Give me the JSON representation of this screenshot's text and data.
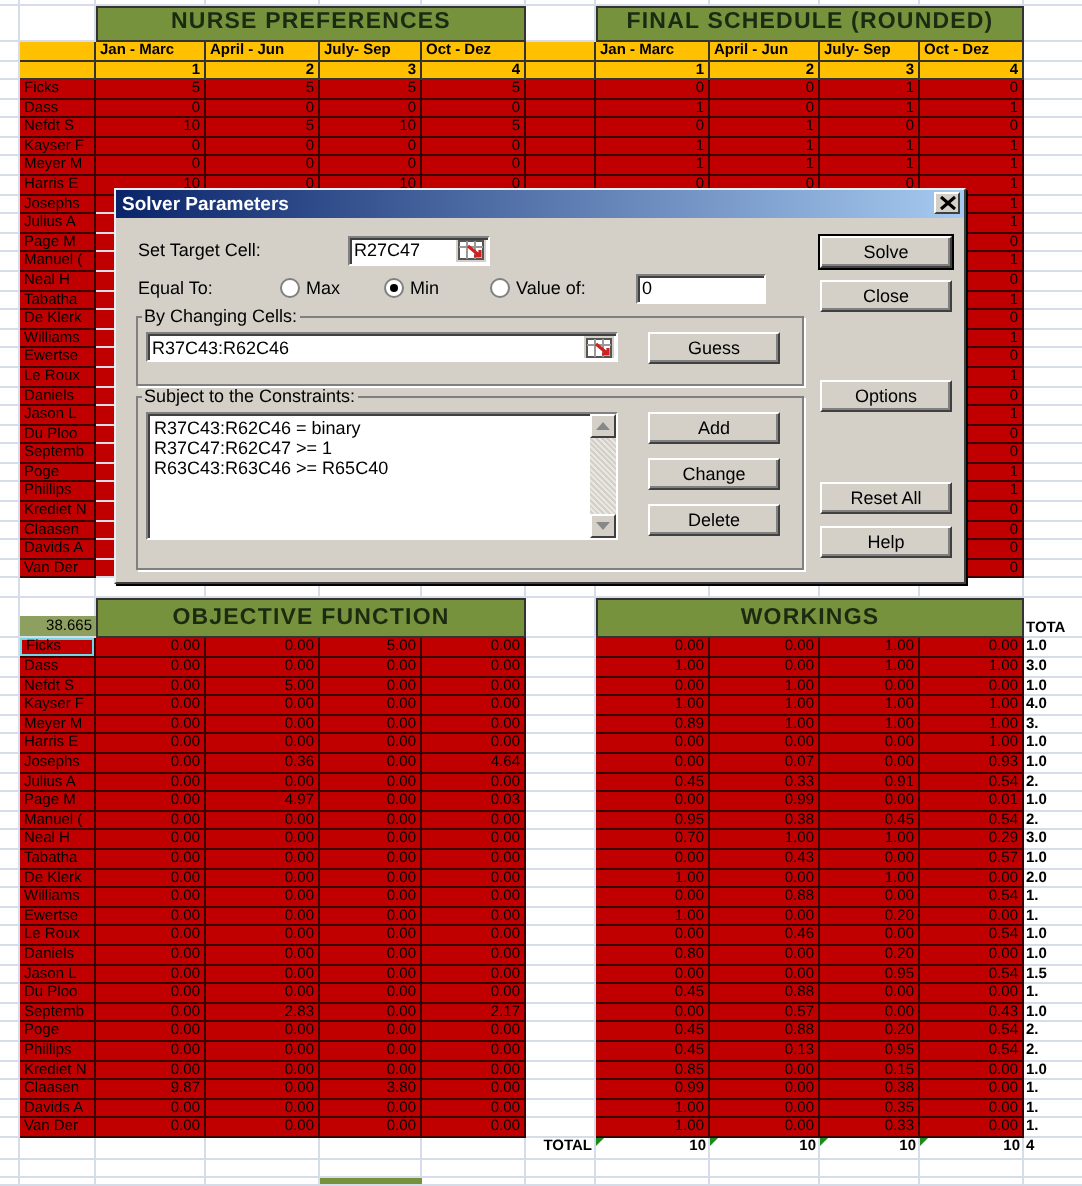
{
  "nurse_preferences": {
    "title": "NURSE PREFERENCES",
    "columns": [
      "Jan - Marc",
      "April - Jun",
      "July- Sep",
      "Oct - Dez"
    ],
    "numbers": [
      "1",
      "2",
      "3",
      "4"
    ]
  },
  "final_schedule": {
    "title": "FINAL SCHEDULE (ROUNDED)",
    "columns": [
      "Jan - Marc",
      "April - Jun",
      "July- Sep",
      "Oct - Dez"
    ],
    "numbers": [
      "1",
      "2",
      "3",
      "4"
    ]
  },
  "top_rows": [
    {
      "name": "Ficks",
      "prefs": [
        "5",
        "5",
        "5",
        "5"
      ],
      "schedule": [
        "0",
        "0",
        "1",
        "0"
      ]
    },
    {
      "name": "Dass",
      "prefs": [
        "0",
        "0",
        "0",
        "0"
      ],
      "schedule": [
        "1",
        "0",
        "1",
        "1"
      ]
    },
    {
      "name": "Nefdt S",
      "prefs": [
        "10",
        "5",
        "10",
        "5"
      ],
      "schedule": [
        "0",
        "1",
        "0",
        "0"
      ]
    },
    {
      "name": "Kayser F",
      "prefs": [
        "0",
        "0",
        "0",
        "0"
      ],
      "schedule": [
        "1",
        "1",
        "1",
        "1"
      ]
    },
    {
      "name": "Meyer M",
      "prefs": [
        "0",
        "0",
        "0",
        "0"
      ],
      "schedule": [
        "1",
        "1",
        "1",
        "1"
      ]
    },
    {
      "name": "Harris E",
      "prefs": [
        "10",
        "0",
        "10",
        "0"
      ],
      "schedule": [
        "0",
        "0",
        "0",
        "1"
      ]
    },
    {
      "name": "Josephs",
      "schedule": [
        "1"
      ]
    },
    {
      "name": "Julius A",
      "schedule": [
        "1"
      ]
    },
    {
      "name": "Page M",
      "schedule": [
        "0"
      ]
    },
    {
      "name": "Manuel (",
      "schedule": [
        "1"
      ]
    },
    {
      "name": "Neal H",
      "schedule": [
        "0"
      ]
    },
    {
      "name": "Tabatha",
      "schedule": [
        "1"
      ]
    },
    {
      "name": "De Klerk",
      "schedule": [
        "0"
      ]
    },
    {
      "name": "Williams",
      "schedule": [
        "1"
      ]
    },
    {
      "name": "Ewertse",
      "schedule": [
        "0"
      ]
    },
    {
      "name": "Le Roux",
      "schedule": [
        "1"
      ]
    },
    {
      "name": "Daniels",
      "schedule": [
        "0"
      ]
    },
    {
      "name": "Jason L",
      "schedule": [
        "1"
      ]
    },
    {
      "name": "Du Ploo",
      "schedule": [
        "0"
      ]
    },
    {
      "name": "Septemb",
      "schedule": [
        "0"
      ]
    },
    {
      "name": "Poge",
      "schedule": [
        "1"
      ]
    },
    {
      "name": "Phillips",
      "schedule": [
        "1"
      ]
    },
    {
      "name": "Krediet N",
      "schedule": [
        "0"
      ]
    },
    {
      "name": "Claasen",
      "schedule": [
        "0"
      ]
    },
    {
      "name": "Davids A",
      "schedule": [
        "0"
      ]
    },
    {
      "name": "Van Der",
      "schedule": [
        "0"
      ]
    }
  ],
  "objective_score": "38.665",
  "objective_function": {
    "title": "OBJECTIVE FUNCTION"
  },
  "workings": {
    "title": "WORKINGS",
    "total_heading": "TOTA"
  },
  "bottom_rows": [
    {
      "name": "Ficks",
      "selected": true,
      "objective": [
        "0.00",
        "0.00",
        "5.00",
        "0.00"
      ],
      "workings": [
        "0.00",
        "0.00",
        "1.00",
        "0.00"
      ],
      "total": "1.0"
    },
    {
      "name": "Dass",
      "selected": false,
      "objective": [
        "0.00",
        "0.00",
        "0.00",
        "0.00"
      ],
      "workings": [
        "1.00",
        "0.00",
        "1.00",
        "1.00"
      ],
      "total": "3.0"
    },
    {
      "name": "Nefdt S",
      "selected": false,
      "objective": [
        "0.00",
        "5.00",
        "0.00",
        "0.00"
      ],
      "workings": [
        "0.00",
        "1.00",
        "0.00",
        "0.00"
      ],
      "total": "1.0"
    },
    {
      "name": "Kayser F",
      "selected": false,
      "objective": [
        "0.00",
        "0.00",
        "0.00",
        "0.00"
      ],
      "workings": [
        "1.00",
        "1.00",
        "1.00",
        "1.00"
      ],
      "total": "4.0"
    },
    {
      "name": "Meyer M",
      "selected": false,
      "objective": [
        "0.00",
        "0.00",
        "0.00",
        "0.00"
      ],
      "workings": [
        "0.89",
        "1.00",
        "1.00",
        "1.00"
      ],
      "total": "3."
    },
    {
      "name": "Harris E",
      "selected": false,
      "objective": [
        "0.00",
        "0.00",
        "0.00",
        "0.00"
      ],
      "workings": [
        "0.00",
        "0.00",
        "0.00",
        "1.00"
      ],
      "total": "1.0"
    },
    {
      "name": "Josephs",
      "selected": false,
      "objective": [
        "0.00",
        "0.36",
        "0.00",
        "4.64"
      ],
      "workings": [
        "0.00",
        "0.07",
        "0.00",
        "0.93"
      ],
      "total": "1.0"
    },
    {
      "name": "Julius A",
      "selected": false,
      "objective": [
        "0.00",
        "0.00",
        "0.00",
        "0.00"
      ],
      "workings": [
        "0.45",
        "0.33",
        "0.91",
        "0.54"
      ],
      "total": "2."
    },
    {
      "name": "Page M",
      "selected": false,
      "objective": [
        "0.00",
        "4.97",
        "0.00",
        "0.03"
      ],
      "workings": [
        "0.00",
        "0.99",
        "0.00",
        "0.01"
      ],
      "total": "1.0"
    },
    {
      "name": "Manuel (",
      "selected": false,
      "objective": [
        "0.00",
        "0.00",
        "0.00",
        "0.00"
      ],
      "workings": [
        "0.95",
        "0.38",
        "0.45",
        "0.54"
      ],
      "total": "2."
    },
    {
      "name": "Neal H",
      "selected": false,
      "objective": [
        "0.00",
        "0.00",
        "0.00",
        "0.00"
      ],
      "workings": [
        "0.70",
        "1.00",
        "1.00",
        "0.29"
      ],
      "total": "3.0"
    },
    {
      "name": "Tabatha",
      "selected": false,
      "objective": [
        "0.00",
        "0.00",
        "0.00",
        "0.00"
      ],
      "workings": [
        "0.00",
        "0.43",
        "0.00",
        "0.57"
      ],
      "total": "1.0"
    },
    {
      "name": "De Klerk",
      "selected": false,
      "objective": [
        "0.00",
        "0.00",
        "0.00",
        "0.00"
      ],
      "workings": [
        "1.00",
        "0.00",
        "1.00",
        "0.00"
      ],
      "total": "2.0"
    },
    {
      "name": "Williams",
      "selected": false,
      "objective": [
        "0.00",
        "0.00",
        "0.00",
        "0.00"
      ],
      "workings": [
        "0.00",
        "0.88",
        "0.00",
        "0.54"
      ],
      "total": "1."
    },
    {
      "name": "Ewertse",
      "selected": false,
      "objective": [
        "0.00",
        "0.00",
        "0.00",
        "0.00"
      ],
      "workings": [
        "1.00",
        "0.00",
        "0.20",
        "0.00"
      ],
      "total": "1."
    },
    {
      "name": "Le Roux",
      "selected": false,
      "objective": [
        "0.00",
        "0.00",
        "0.00",
        "0.00"
      ],
      "workings": [
        "0.00",
        "0.46",
        "0.00",
        "0.54"
      ],
      "total": "1.0"
    },
    {
      "name": "Daniels",
      "selected": false,
      "objective": [
        "0.00",
        "0.00",
        "0.00",
        "0.00"
      ],
      "workings": [
        "0.80",
        "0.00",
        "0.20",
        "0.00"
      ],
      "total": "1.0"
    },
    {
      "name": "Jason L",
      "selected": false,
      "objective": [
        "0.00",
        "0.00",
        "0.00",
        "0.00"
      ],
      "workings": [
        "0.00",
        "0.00",
        "0.95",
        "0.54"
      ],
      "total": "1.5"
    },
    {
      "name": "Du Ploo",
      "selected": false,
      "objective": [
        "0.00",
        "0.00",
        "0.00",
        "0.00"
      ],
      "workings": [
        "0.45",
        "0.88",
        "0.00",
        "0.00"
      ],
      "total": "1."
    },
    {
      "name": "Septemb",
      "selected": false,
      "objective": [
        "0.00",
        "2.83",
        "0.00",
        "2.17"
      ],
      "workings": [
        "0.00",
        "0.57",
        "0.00",
        "0.43"
      ],
      "total": "1.0"
    },
    {
      "name": "Poge",
      "selected": false,
      "objective": [
        "0.00",
        "0.00",
        "0.00",
        "0.00"
      ],
      "workings": [
        "0.45",
        "0.88",
        "0.20",
        "0.54"
      ],
      "total": "2."
    },
    {
      "name": "Phillips",
      "selected": false,
      "objective": [
        "0.00",
        "0.00",
        "0.00",
        "0.00"
      ],
      "workings": [
        "0.45",
        "0.13",
        "0.95",
        "0.54"
      ],
      "total": "2."
    },
    {
      "name": "Krediet N",
      "selected": false,
      "objective": [
        "0.00",
        "0.00",
        "0.00",
        "0.00"
      ],
      "workings": [
        "0.85",
        "0.00",
        "0.15",
        "0.00"
      ],
      "total": "1.0"
    },
    {
      "name": "Claasen",
      "selected": false,
      "objective": [
        "9.87",
        "0.00",
        "3.80",
        "0.00"
      ],
      "workings": [
        "0.99",
        "0.00",
        "0.38",
        "0.00"
      ],
      "total": "1."
    },
    {
      "name": "Davids A",
      "selected": false,
      "objective": [
        "0.00",
        "0.00",
        "0.00",
        "0.00"
      ],
      "workings": [
        "1.00",
        "0.00",
        "0.35",
        "0.00"
      ],
      "total": "1."
    },
    {
      "name": "Van Der",
      "selected": false,
      "objective": [
        "0.00",
        "0.00",
        "0.00",
        "0.00"
      ],
      "workings": [
        "1.00",
        "0.00",
        "0.33",
        "0.00"
      ],
      "total": "1."
    }
  ],
  "totals": {
    "label": "TOTAL",
    "values": [
      "10",
      "10",
      "10",
      "10"
    ],
    "grand": "4"
  },
  "solver": {
    "title": "Solver Parameters",
    "target_label": "Set Target Cell:",
    "target": "R27C47",
    "equal_label": "Equal To:",
    "equal_options": [
      {
        "label": "Max",
        "selected": false
      },
      {
        "label": "Min",
        "selected": true
      },
      {
        "label": "Value of:",
        "selected": false
      }
    ],
    "value": "0",
    "changing_label": "By Changing Cells:",
    "changing": "R37C43:R62C46",
    "guess_button": "Guess",
    "constraints_label": "Subject to the Constraints:",
    "constraints": [
      "R37C43:R62C46 = binary",
      "R37C47:R62C47 >= 1",
      "R63C43:R63C46 >= R65C40"
    ],
    "constraint_buttons": [
      "Add",
      "Change",
      "Delete"
    ],
    "side_buttons": [
      {
        "label": "Solve",
        "default": true
      },
      {
        "label": "Close",
        "default": false
      },
      {
        "label": "Options",
        "default": false
      },
      {
        "label": "Reset All",
        "default": false
      },
      {
        "label": "Help",
        "default": false
      }
    ]
  }
}
